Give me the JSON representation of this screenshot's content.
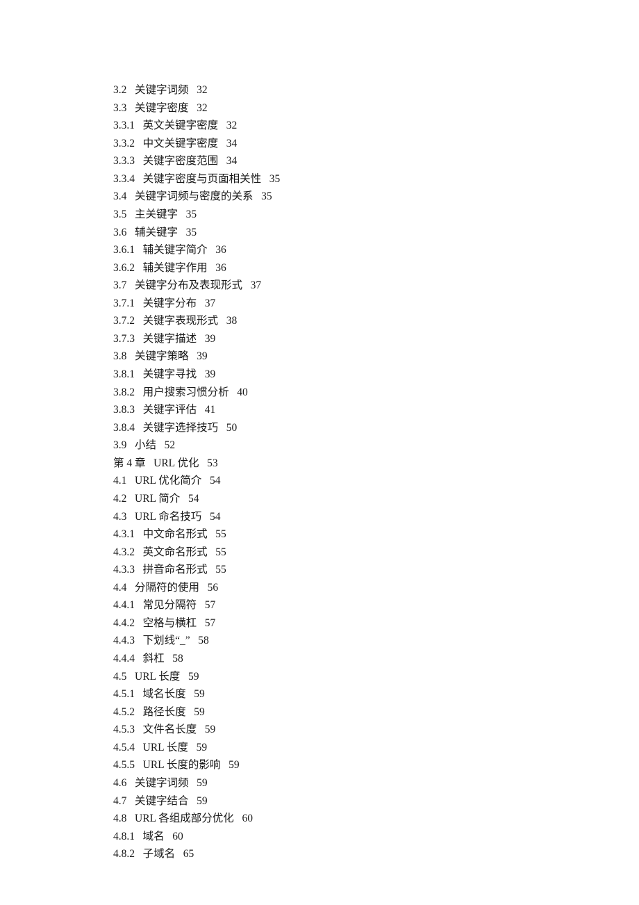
{
  "toc": [
    {
      "num": "3.2",
      "title": "关键字词频",
      "page": "32"
    },
    {
      "num": "3.3",
      "title": "关键字密度",
      "page": "32"
    },
    {
      "num": "3.3.1",
      "title": "英文关键字密度",
      "page": "32"
    },
    {
      "num": "3.3.2",
      "title": "中文关键字密度",
      "page": "34"
    },
    {
      "num": "3.3.3",
      "title": "关键字密度范围",
      "page": "34"
    },
    {
      "num": "3.3.4",
      "title": "关键字密度与页面相关性",
      "page": "35"
    },
    {
      "num": "3.4",
      "title": "关键字词频与密度的关系",
      "page": "35"
    },
    {
      "num": "3.5",
      "title": "主关键字",
      "page": "35"
    },
    {
      "num": "3.6",
      "title": "辅关键字",
      "page": "35"
    },
    {
      "num": "3.6.1",
      "title": "辅关键字简介",
      "page": "36"
    },
    {
      "num": "3.6.2",
      "title": "辅关键字作用",
      "page": "36"
    },
    {
      "num": "3.7",
      "title": "关键字分布及表现形式",
      "page": "37"
    },
    {
      "num": "3.7.1",
      "title": "关键字分布",
      "page": "37"
    },
    {
      "num": "3.7.2",
      "title": "关键字表现形式",
      "page": "38"
    },
    {
      "num": "3.7.3",
      "title": "关键字描述",
      "page": "39"
    },
    {
      "num": "3.8",
      "title": "关键字策略",
      "page": "39"
    },
    {
      "num": "3.8.1",
      "title": "关键字寻找",
      "page": "39"
    },
    {
      "num": "3.8.2",
      "title": "用户搜索习惯分析",
      "page": "40"
    },
    {
      "num": "3.8.3",
      "title": "关键字评估",
      "page": "41"
    },
    {
      "num": "3.8.4",
      "title": "关键字选择技巧",
      "page": "50"
    },
    {
      "num": "3.9",
      "title": "小结",
      "page": "52"
    },
    {
      "num": "第 4 章",
      "title": "URL 优化",
      "page": "53",
      "chapter": true
    },
    {
      "num": "4.1",
      "title": "URL 优化简介",
      "page": "54"
    },
    {
      "num": "4.2",
      "title": "URL 简介",
      "page": "54"
    },
    {
      "num": "4.3",
      "title": "URL 命名技巧",
      "page": "54"
    },
    {
      "num": "4.3.1",
      "title": "中文命名形式",
      "page": "55"
    },
    {
      "num": "4.3.2",
      "title": "英文命名形式",
      "page": "55"
    },
    {
      "num": "4.3.3",
      "title": "拼音命名形式",
      "page": "55"
    },
    {
      "num": "4.4",
      "title": "分隔符的使用",
      "page": "56"
    },
    {
      "num": "4.4.1",
      "title": "常见分隔符",
      "page": "57"
    },
    {
      "num": "4.4.2",
      "title": "空格与横杠",
      "page": "57"
    },
    {
      "num": "4.4.3",
      "title": "下划线“_”",
      "page": "58"
    },
    {
      "num": "4.4.4",
      "title": "斜杠",
      "page": "58"
    },
    {
      "num": "4.5",
      "title": "URL 长度",
      "page": "59"
    },
    {
      "num": "4.5.1",
      "title": "域名长度",
      "page": "59"
    },
    {
      "num": "4.5.2",
      "title": "路径长度",
      "page": "59"
    },
    {
      "num": "4.5.3",
      "title": "文件名长度",
      "page": "59"
    },
    {
      "num": "4.5.4",
      "title": "URL 长度",
      "page": "59"
    },
    {
      "num": "4.5.5",
      "title": "URL 长度的影响",
      "page": "59"
    },
    {
      "num": "4.6",
      "title": "关键字词频",
      "page": "59"
    },
    {
      "num": "4.7",
      "title": "关键字结合",
      "page": "59"
    },
    {
      "num": "4.8",
      "title": "URL 各组成部分优化",
      "page": "60"
    },
    {
      "num": "4.8.1",
      "title": "域名",
      "page": "60"
    },
    {
      "num": "4.8.2",
      "title": "子域名",
      "page": "65"
    }
  ]
}
